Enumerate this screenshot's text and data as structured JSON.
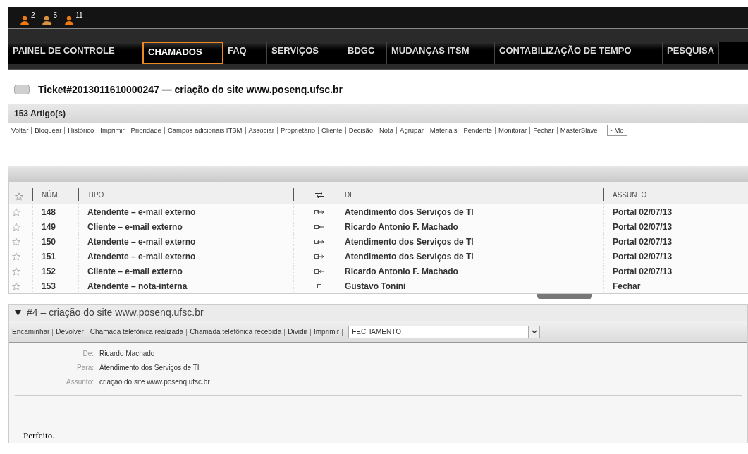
{
  "notifications": [
    {
      "count": "2",
      "kind": "person"
    },
    {
      "count": "5",
      "kind": "star"
    },
    {
      "count": "11",
      "kind": "person"
    }
  ],
  "nav": [
    {
      "label": "PAINEL DE CONTROLE",
      "selected": false
    },
    {
      "label": "CHAMADOS",
      "selected": true
    },
    {
      "label": "FAQ",
      "selected": false
    },
    {
      "label": "SERVIÇOS",
      "selected": false
    },
    {
      "label": "BDGC",
      "selected": false
    },
    {
      "label": "MUDANÇAS ITSM",
      "selected": false
    },
    {
      "label": "CONTABILIZAÇÃO DE TEMPO",
      "selected": false
    },
    {
      "label": "PESQUISA",
      "selected": false
    }
  ],
  "ticket_title": "Ticket#2013011610000247 — criação do site www.posenq.ufsc.br",
  "article_count": "153 Artigo(s)",
  "actions": [
    "Voltar",
    "Bloquear",
    "Histórico",
    "Imprimir",
    "Prioridade",
    "Campos adicionais ITSM",
    "Associar",
    "Proprietário",
    "Cliente",
    "Decisão",
    "Nota",
    "Agrupar",
    "Materiais",
    "Pendente",
    "Monitorar",
    "Fechar",
    "MasterSlave"
  ],
  "actions_select": "- Mo",
  "table": {
    "columns": [
      "NÚM.",
      "TIPO",
      "DE",
      "ASSUNTO"
    ],
    "rows": [
      {
        "num": "148",
        "tipo": "Atendente – e-mail externo",
        "kind": "out",
        "de": "Atendimento dos Serviços de TI",
        "assunto": "Portal 02/07/13"
      },
      {
        "num": "149",
        "tipo": "Cliente – e-mail externo",
        "kind": "in",
        "de": "Ricardo Antonio F. Machado",
        "assunto": "Portal 02/07/13"
      },
      {
        "num": "150",
        "tipo": "Atendente – e-mail externo",
        "kind": "out",
        "de": "Atendimento dos Serviços de TI",
        "assunto": "Portal 02/07/13"
      },
      {
        "num": "151",
        "tipo": "Atendente – e-mail externo",
        "kind": "out",
        "de": "Atendimento dos Serviços de TI",
        "assunto": "Portal 02/07/13"
      },
      {
        "num": "152",
        "tipo": "Cliente – e-mail externo",
        "kind": "in",
        "de": "Ricardo Antonio F. Machado",
        "assunto": "Portal 02/07/13"
      },
      {
        "num": "153",
        "tipo": "Atendente – nota-interna",
        "kind": "note",
        "de": "Gustavo Tonini",
        "assunto": "Fechar"
      }
    ]
  },
  "article": {
    "title": "#4 – criação do site www.posenq.ufsc.br",
    "expanded": true,
    "actions": [
      "Encaminhar",
      "Devolver",
      "Chamada telefônica realizada",
      "Chamada telefônica recebida",
      "Dividir",
      "Imprimir"
    ],
    "select": "FECHAMENTO",
    "fields": [
      {
        "label": "De:",
        "value": "Ricardo Machado"
      },
      {
        "label": "Para:",
        "value": "Atendimento dos Serviços de TI"
      },
      {
        "label": "Assunto:",
        "value": "criação do site www.posenq.ufsc.br"
      }
    ],
    "body": "Perfeito."
  }
}
